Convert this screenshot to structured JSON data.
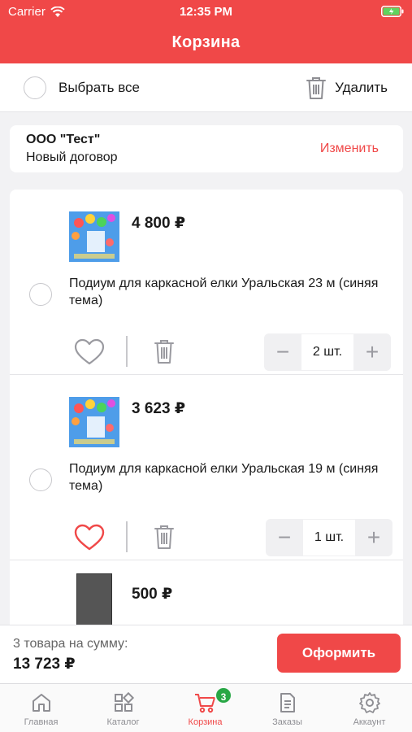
{
  "status_bar": {
    "carrier": "Carrier",
    "time": "12:35 PM"
  },
  "header": {
    "title": "Корзина"
  },
  "select_bar": {
    "select_all_label": "Выбрать все",
    "delete_label": "Удалить"
  },
  "contract": {
    "company": "ООО \"Тест\"",
    "contract_name": "Новый договор",
    "change_label": "Изменить"
  },
  "items": [
    {
      "price": "4 800 ₽",
      "name": "Подиум для каркасной елки Уральская 23 м (синяя тема)",
      "quantity": "2 шт.",
      "favorite": false
    },
    {
      "price": "3 623 ₽",
      "name": "Подиум для каркасной елки Уральская 19 м (синяя тема)",
      "quantity": "1 шт.",
      "favorite": true
    },
    {
      "price": "500 ₽"
    }
  ],
  "checkout": {
    "summary_label": "3 товара на сумму:",
    "total": "13 723 ₽",
    "button_label": "Оформить"
  },
  "tabbar": {
    "tabs": [
      {
        "label": "Главная",
        "icon": "home-icon"
      },
      {
        "label": "Каталог",
        "icon": "grid-icon"
      },
      {
        "label": "Корзина",
        "icon": "cart-icon",
        "badge": "3",
        "active": true
      },
      {
        "label": "Заказы",
        "icon": "document-icon"
      },
      {
        "label": "Аккаунт",
        "icon": "gear-icon"
      }
    ]
  },
  "colors": {
    "accent": "#f04848",
    "badge": "#28a745",
    "muted": "#8e8e93"
  }
}
